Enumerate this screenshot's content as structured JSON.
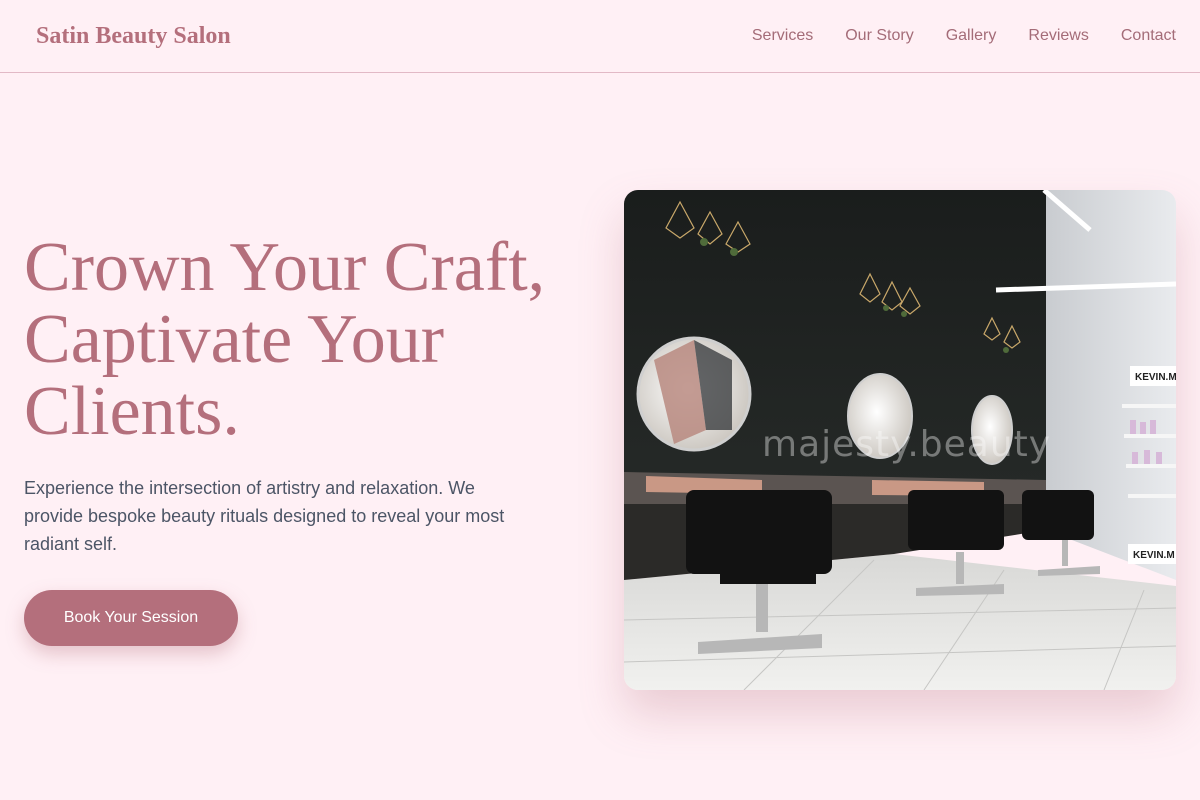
{
  "header": {
    "brand": "Satin Beauty Salon",
    "nav": [
      "Services",
      "Our Story",
      "Gallery",
      "Reviews",
      "Contact"
    ]
  },
  "hero": {
    "title_lines": [
      "Crown Your Craft,",
      "Captivate Your",
      "Clients."
    ],
    "description": "Experience the intersection of artistry and relaxation. We provide bespoke beauty rituals designed to reveal your most radiant self.",
    "cta_label": "Book Your Session"
  },
  "image": {
    "watermark": "majesty.beauty",
    "signs": [
      "KEVIN.M",
      "KEVIN.M"
    ]
  },
  "colors": {
    "background": "#fff0f5",
    "accent": "#b46f7c",
    "body_text": "#4c5566"
  }
}
